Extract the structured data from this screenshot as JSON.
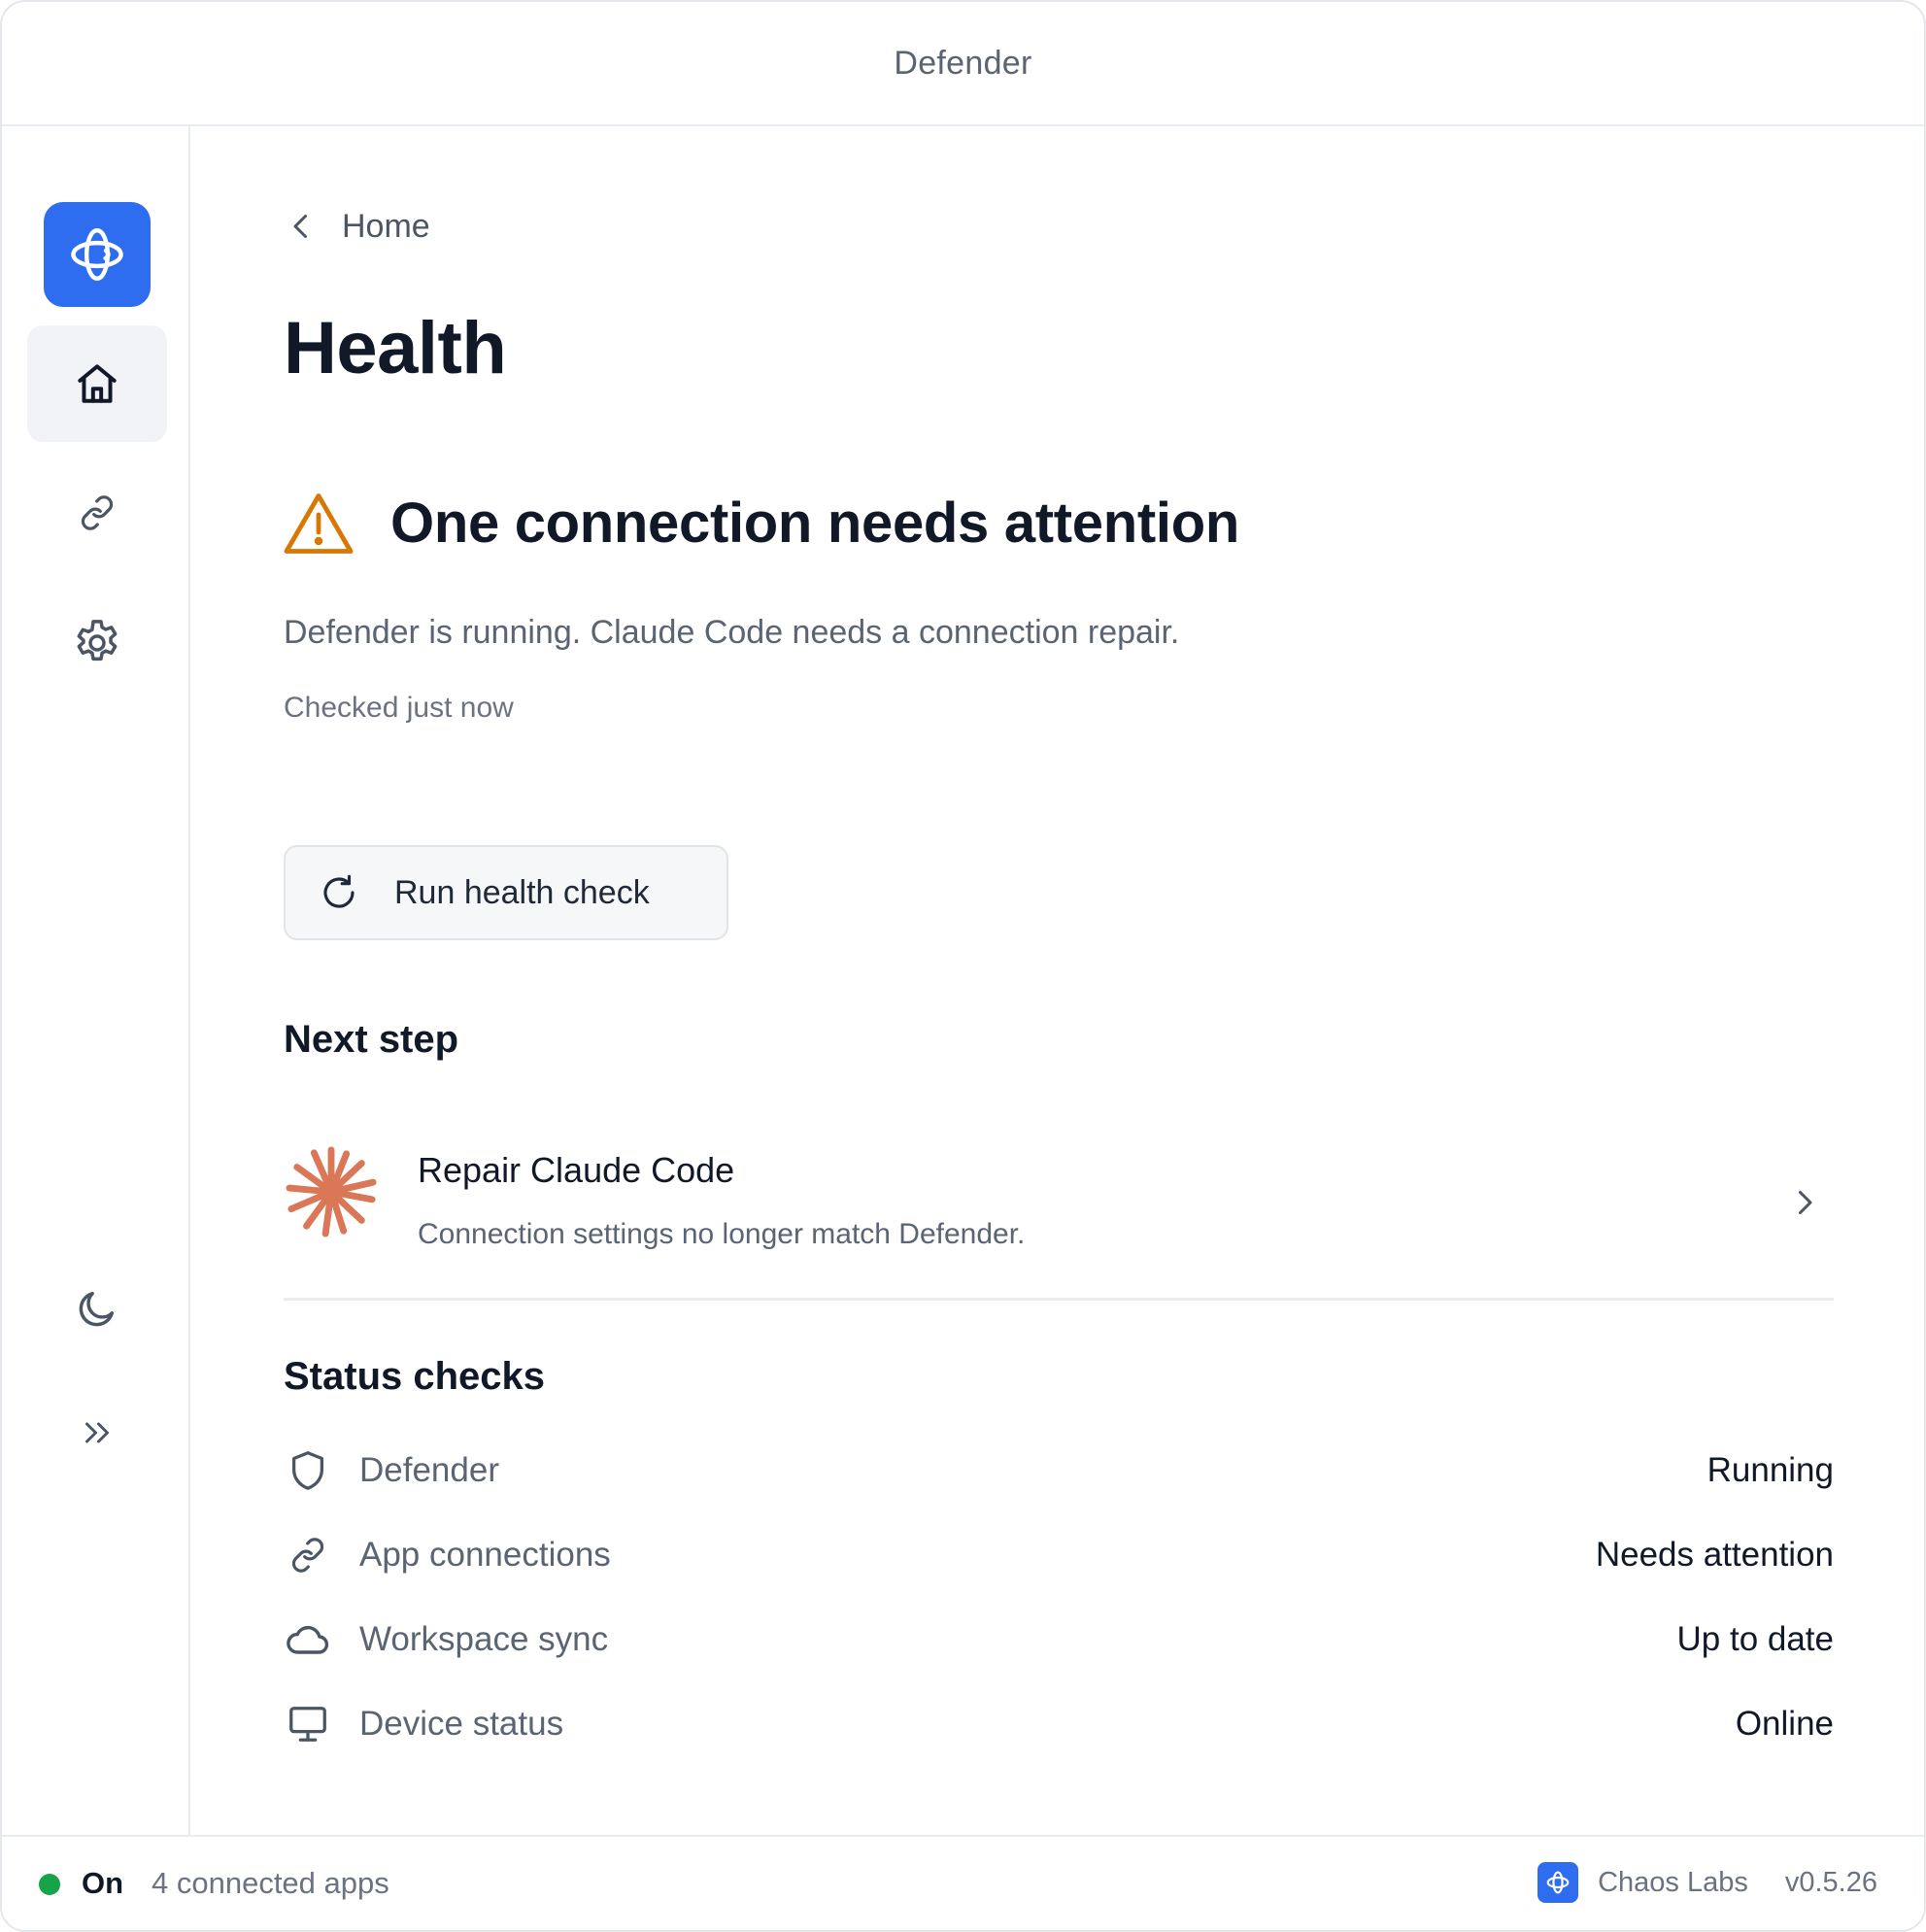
{
  "window": {
    "title": "Defender"
  },
  "sidebar": {
    "items": [
      {
        "name": "home",
        "icon": "home-icon",
        "active": true
      },
      {
        "name": "connections",
        "icon": "link-icon",
        "active": false
      },
      {
        "name": "settings",
        "icon": "gear-icon",
        "active": false
      }
    ],
    "bottom": [
      {
        "name": "theme",
        "icon": "moon-icon"
      },
      {
        "name": "expand",
        "icon": "double-chevron-right-icon"
      }
    ]
  },
  "breadcrumb": {
    "label": "Home"
  },
  "page": {
    "title": "Health"
  },
  "alert": {
    "title": "One connection needs attention",
    "description": "Defender is running. Claude Code needs a connection repair.",
    "checked": "Checked just now",
    "icon": "warning-triangle-icon",
    "color": "#d97706"
  },
  "actions": {
    "run_health_check": "Run health check"
  },
  "next_step": {
    "heading": "Next step",
    "item": {
      "title": "Repair Claude Code",
      "description": "Connection settings no longer match Defender.",
      "icon": "claude-starburst-icon",
      "color": "#d97757"
    }
  },
  "status_checks": {
    "heading": "Status checks",
    "rows": [
      {
        "name": "Defender",
        "value": "Running",
        "icon": "shield-icon"
      },
      {
        "name": "App connections",
        "value": "Needs attention",
        "icon": "link-icon"
      },
      {
        "name": "Workspace sync",
        "value": "Up to date",
        "icon": "cloud-icon"
      },
      {
        "name": "Device status",
        "value": "Online",
        "icon": "monitor-icon"
      }
    ]
  },
  "statusbar": {
    "state": "On",
    "apps": "4 connected apps",
    "company": "Chaos Labs",
    "version": "v0.5.26",
    "state_color": "#16a34a"
  },
  "colors": {
    "accent": "#2f6df0",
    "warning": "#d97706"
  }
}
